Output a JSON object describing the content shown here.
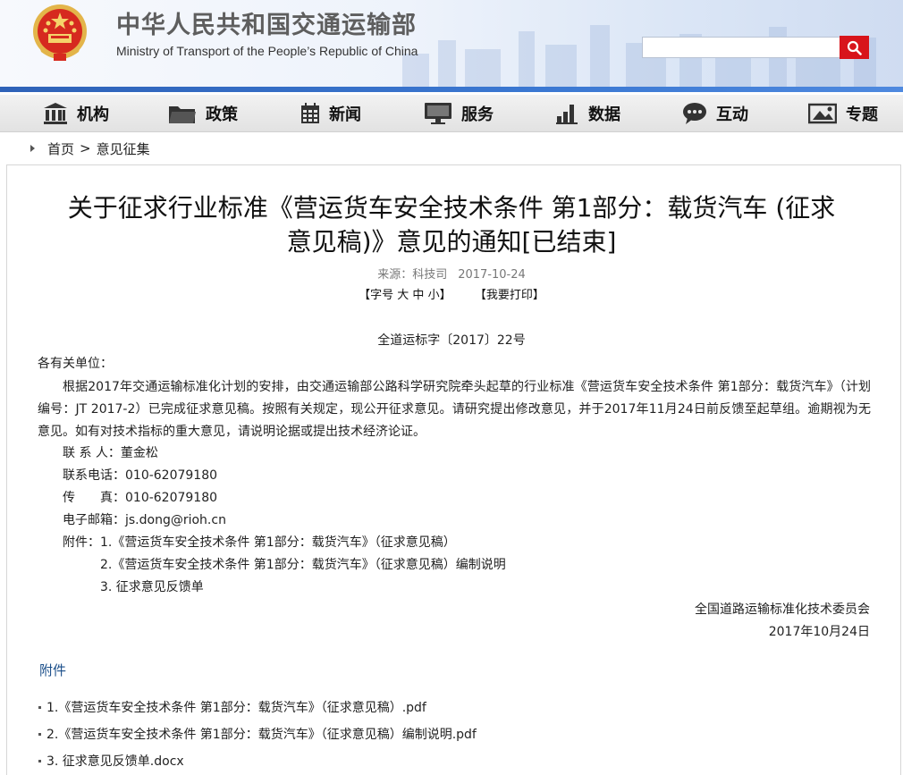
{
  "header": {
    "title_cn": "中华人民共和国交通运输部",
    "title_en": "Ministry of Transport of the People’s Republic of China",
    "search_placeholder": ""
  },
  "nav": [
    {
      "label": "机构",
      "icon": "building-icon"
    },
    {
      "label": "政策",
      "icon": "folder-icon"
    },
    {
      "label": "新闻",
      "icon": "calendar-icon"
    },
    {
      "label": "服务",
      "icon": "monitor-icon"
    },
    {
      "label": "数据",
      "icon": "bar-chart-icon"
    },
    {
      "label": "互动",
      "icon": "chat-icon"
    },
    {
      "label": "专题",
      "icon": "image-icon"
    }
  ],
  "breadcrumb": {
    "home": "首页",
    "separator": ">",
    "current": "意见征集"
  },
  "article": {
    "title_line1": "关于征求行业标准《营运货车安全技术条件 第1部分：载货汽车 (征求",
    "title_line2": "意见稿)》意见的通知[已结束]",
    "source": "来源：科技司",
    "date": "2017-10-24",
    "font_size_label": "【字号",
    "font_large": "大",
    "font_medium": "中",
    "font_small": "小】",
    "print_label": "【我要打印】",
    "doc_number": "全道运标字〔2017〕22号",
    "salutation": "各有关单位：",
    "paragraph": "根据2017年交通运输标准化计划的安排，由交通运输部公路科学研究院牵头起草的行业标准《营运货车安全技术条件 第1部分：载货汽车》（计划编号：JT 2017-2）已完成征求意见稿。按照有关规定，现公开征求意见。请研究提出修改意见，并于2017年11月24日前反馈至起草组。逾期视为无意见。如有对技术指标的重大意见，请说明论据或提出技术经济论证。",
    "contact": "联 系 人：董金松",
    "phone": "联系电话：010-62079180",
    "fax": "传　　真：010-62079180",
    "email": "电子邮箱：js.dong@rioh.cn",
    "attach1": "附件：1.《营运货车安全技术条件 第1部分：载货汽车》（征求意见稿）",
    "attach2": "2.《营运货车安全技术条件 第1部分：载货汽车》（征求意见稿）编制说明",
    "attach3": "3. 征求意见反馈单",
    "signer": "全国道路运输标准化技术委员会",
    "sign_date": "2017年10月24日"
  },
  "attachments": {
    "heading": "附件",
    "files": [
      "1.《营运货车安全技术条件 第1部分：载货汽车》（征求意见稿）.pdf",
      "2.《营运货车安全技术条件 第1部分：载货汽车》（征求意见稿）编制说明.pdf",
      "3. 征求意见反馈单.docx"
    ]
  },
  "colors": {
    "accent_red": "#d8141b",
    "nav_blue": "#2e62b8",
    "link_blue": "#1b4f8a"
  }
}
